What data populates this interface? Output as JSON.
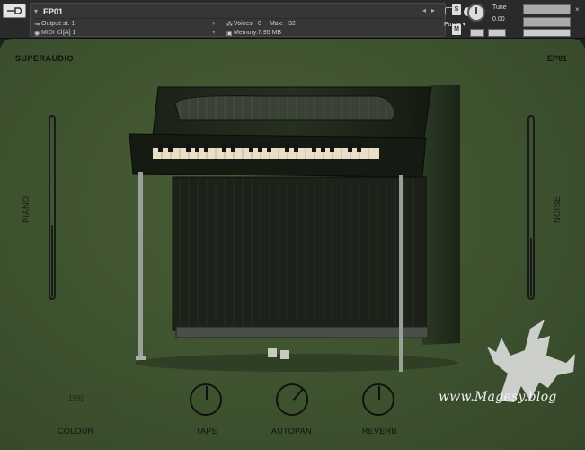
{
  "header": {
    "instrument_name": "EP01",
    "output_label": "Output:",
    "output_value": "st. 1",
    "midi_label": "MIDI Ch:",
    "midi_value": "[A]  1",
    "voices_label": "Voices:",
    "voices_value": "0",
    "max_label": "Max:",
    "max_value": "32",
    "memory_label": "Memory:",
    "memory_value": "7.95 MB",
    "purge_label": "Purge",
    "tune_label": "Tune",
    "tune_value": "0.00",
    "s_button": "S",
    "m_button": "M",
    "icons": [
      "wrench-icon",
      "camera-icon",
      "info-icon",
      "close-icon",
      "aux-icon",
      "pv-icon"
    ]
  },
  "main": {
    "brand": "SUPERAUDIO",
    "product": "EP01",
    "left_slider_label": "PIANO",
    "left_slider_level": 0.4,
    "right_slider_label": "NOISE",
    "right_slider_level": 0.33,
    "colour_value": "1990",
    "colour_label": "COLOUR",
    "knobs": [
      {
        "label": "TAPE",
        "value": 0.5
      },
      {
        "label": "AUTOPAN",
        "value": 0.65
      },
      {
        "label": "REVERB",
        "value": 0.5
      }
    ]
  },
  "watermark": {
    "text": "www.Magesy.blog"
  },
  "colors": {
    "panel_green": "#3f5430",
    "piano_body": "#1a2216",
    "header_bg": "#2a2a2a"
  }
}
